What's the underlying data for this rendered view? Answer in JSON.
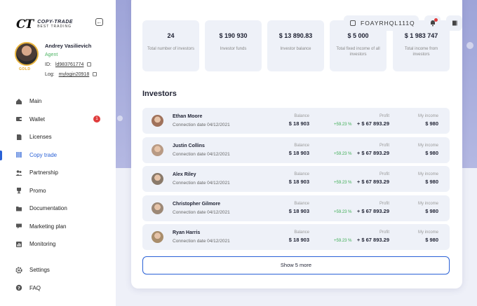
{
  "brand": {
    "mark": "CT",
    "name": "COPY-TRADE",
    "tagline": "BEST TRADING"
  },
  "user": {
    "name": "Andrey Vasilievich",
    "role": "Agent",
    "level": "GOLD",
    "id_label": "ID:",
    "id_value": "ld983761774",
    "log_label": "Log:",
    "log_value": "mylogin20918"
  },
  "nav": {
    "items": [
      {
        "label": "Main",
        "icon": "home-icon"
      },
      {
        "label": "Wallet",
        "icon": "wallet-icon",
        "badge": "1"
      },
      {
        "label": "Licenses",
        "icon": "document-icon"
      },
      {
        "label": "Copy trade",
        "icon": "copy-trade-icon",
        "active": true
      },
      {
        "label": "Partnership",
        "icon": "people-icon"
      },
      {
        "label": "Promo",
        "icon": "trophy-icon"
      },
      {
        "label": "Documentation",
        "icon": "folder-icon"
      },
      {
        "label": "Marketing plan",
        "icon": "chat-icon"
      },
      {
        "label": "Monitoring",
        "icon": "chart-icon"
      }
    ],
    "bottom": [
      {
        "label": "Settings",
        "icon": "gear-icon"
      },
      {
        "label": "FAQ",
        "icon": "question-icon"
      }
    ]
  },
  "header": {
    "ref_code": "FOAYRHQL111Q"
  },
  "stats": [
    {
      "value": "24",
      "label": "Total number of investors"
    },
    {
      "value": "$ 190 930",
      "label": "Investor funds"
    },
    {
      "value": "$ 13 890.83",
      "label": "Investor balance"
    },
    {
      "value": "$ 5 000",
      "label": "Total fixed income of all investors"
    },
    {
      "value": "$ 1 983 747",
      "label": "Total income from investors"
    }
  ],
  "investors": {
    "title": "Investors",
    "col_balance": "Balance",
    "col_profit": "Profit",
    "col_income": "My income",
    "rows": [
      {
        "name": "Ethan Moore",
        "date": "Connection date 04/12/2021",
        "balance": "$ 18 903",
        "pct": "+59.23 %",
        "profit": "+ $ 67 893.29",
        "income": "$ 980"
      },
      {
        "name": "Justin Collins",
        "date": "Connection date 04/12/2021",
        "balance": "$ 18 903",
        "pct": "+59.23 %",
        "profit": "+ $ 67 893.29",
        "income": "$ 980"
      },
      {
        "name": "Alex Riley",
        "date": "Connection date 04/12/2021",
        "balance": "$ 18 903",
        "pct": "+59.23 %",
        "profit": "+ $ 67 893.29",
        "income": "$ 980"
      },
      {
        "name": "Christopher Gilmore",
        "date": "Connection date 04/12/2021",
        "balance": "$ 18 903",
        "pct": "+59.23 %",
        "profit": "+ $ 67 893.29",
        "income": "$ 980"
      },
      {
        "name": "Ryan Harris",
        "date": "Connection date 04/12/2021",
        "balance": "$ 18 903",
        "pct": "+59.23 %",
        "profit": "+ $ 67 893.29",
        "income": "$ 980"
      }
    ],
    "show_more": "Show 5 more"
  },
  "colors": {
    "accent": "#2a61d6",
    "positive": "#3fae56",
    "badge": "#e03c3c",
    "gold": "#e8b33c"
  }
}
